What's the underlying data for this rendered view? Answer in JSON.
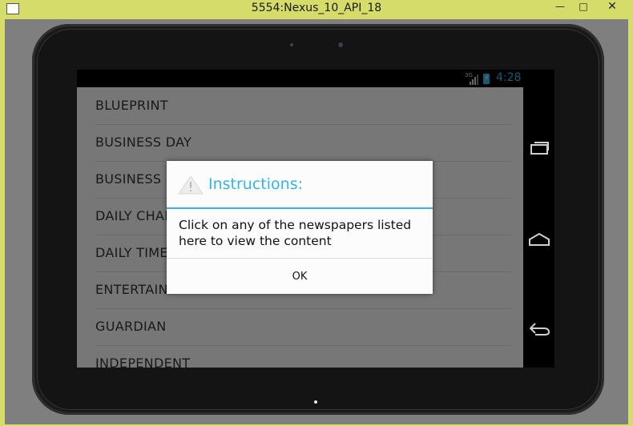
{
  "window": {
    "title": "5554:Nexus_10_API_18",
    "minimize_glyph": "—",
    "maximize_glyph": "□",
    "close_glyph": "✕"
  },
  "statusbar": {
    "network_label": "3G",
    "time": "4:28",
    "accent_color": "#33b5e5"
  },
  "list": {
    "items": [
      "BLUEPRINT",
      "BUSINESS DAY",
      "BUSINESS HALLMARK",
      "DAILY CHAMPION",
      "DAILY TIMES",
      "ENTERTAINMENT",
      "GUARDIAN",
      "INDEPENDENT"
    ]
  },
  "dialog": {
    "icon": "warning-icon",
    "title": "Instructions:",
    "message": "Click on any of the newspapers listed here to view the content",
    "ok_label": "OK"
  },
  "navbar": {
    "icons": [
      "recent-apps-icon",
      "home-icon",
      "back-icon"
    ]
  }
}
